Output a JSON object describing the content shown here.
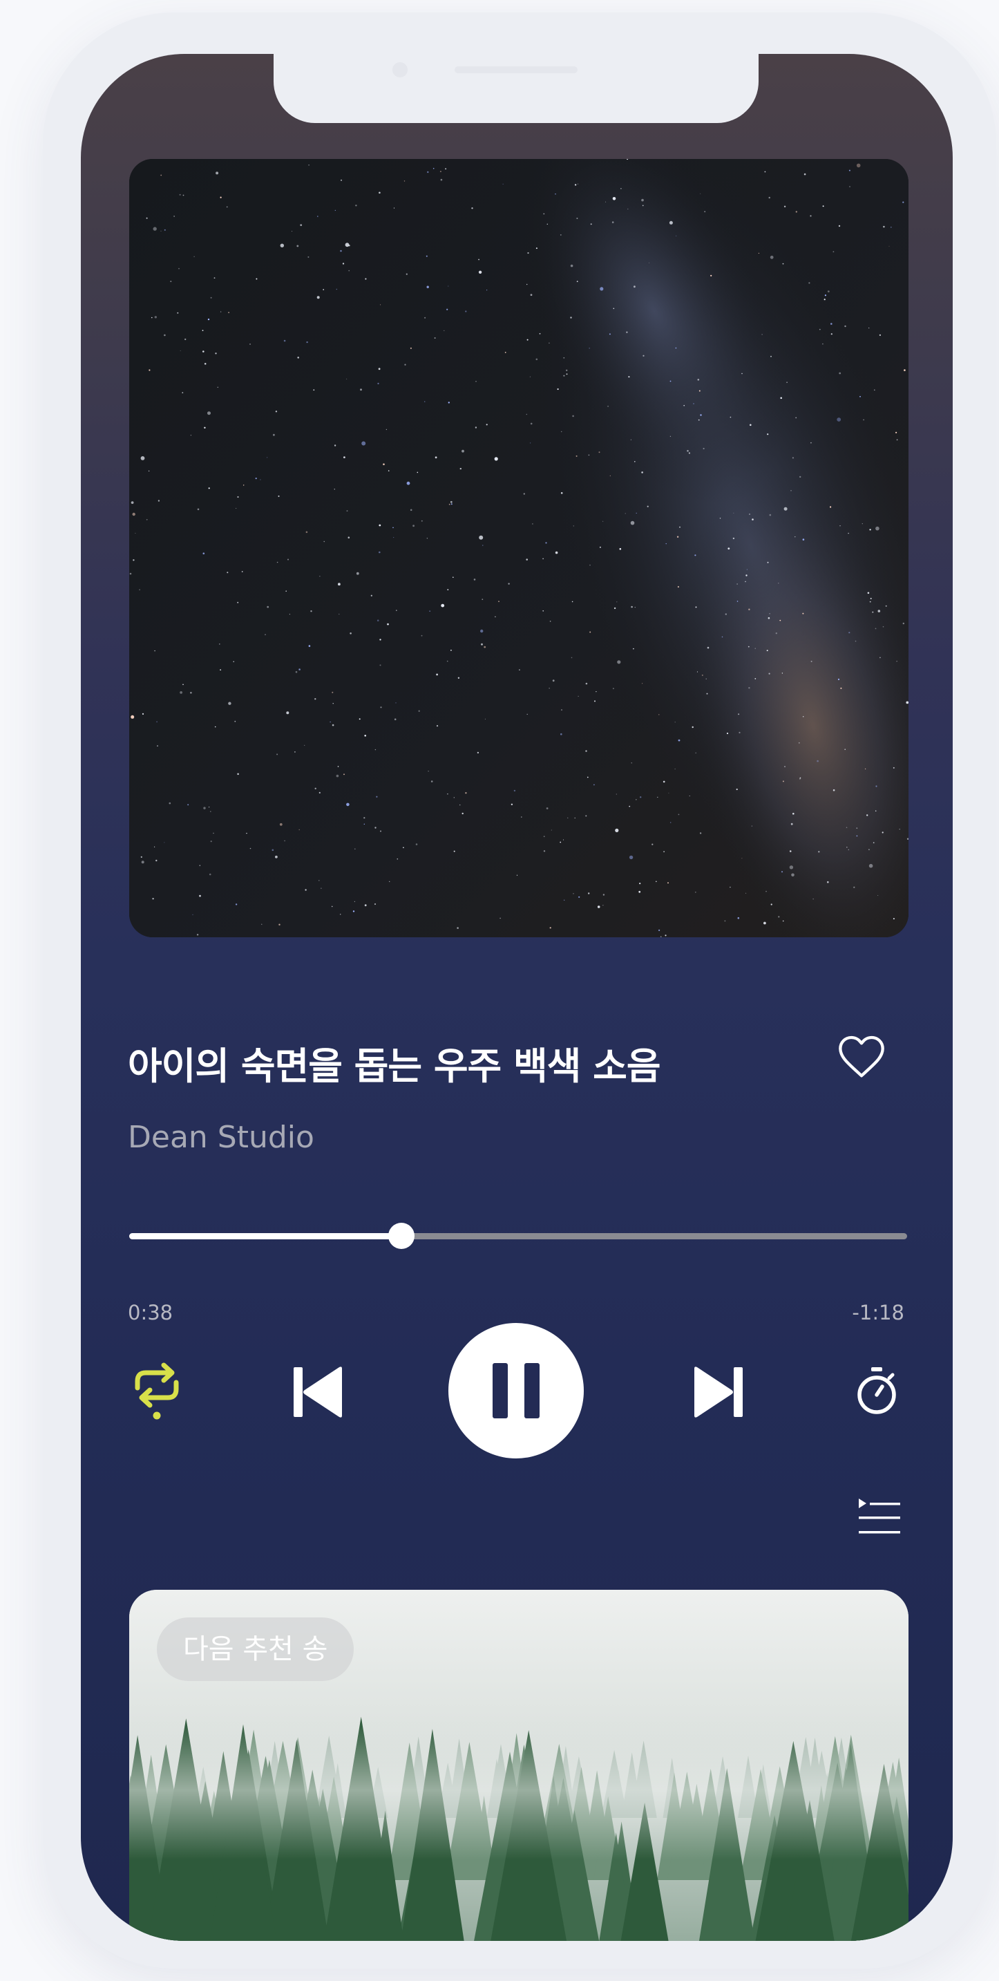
{
  "track": {
    "title": "아이의 숙면을 돕는 우주 백색 소음",
    "artist": "Dean Studio",
    "liked": false
  },
  "playback": {
    "elapsed_label": "0:38",
    "remaining_label": "-1:18",
    "progress": 0.35,
    "state": "playing",
    "repeat_active": true
  },
  "controls": {
    "repeat_icon": "repeat-icon",
    "prev_icon": "skip-previous-icon",
    "pause_icon": "pause-icon",
    "next_icon": "skip-next-icon",
    "timer_icon": "stopwatch-icon",
    "queue_icon": "queue-list-icon",
    "like_icon": "heart-outline-icon"
  },
  "next_card": {
    "label": "다음 추천 송"
  },
  "colors": {
    "accent_active": "#d8e04a",
    "icon": "#ffffff",
    "progress_track": "#8a8b92",
    "artist_text": "#a7a9b5"
  }
}
